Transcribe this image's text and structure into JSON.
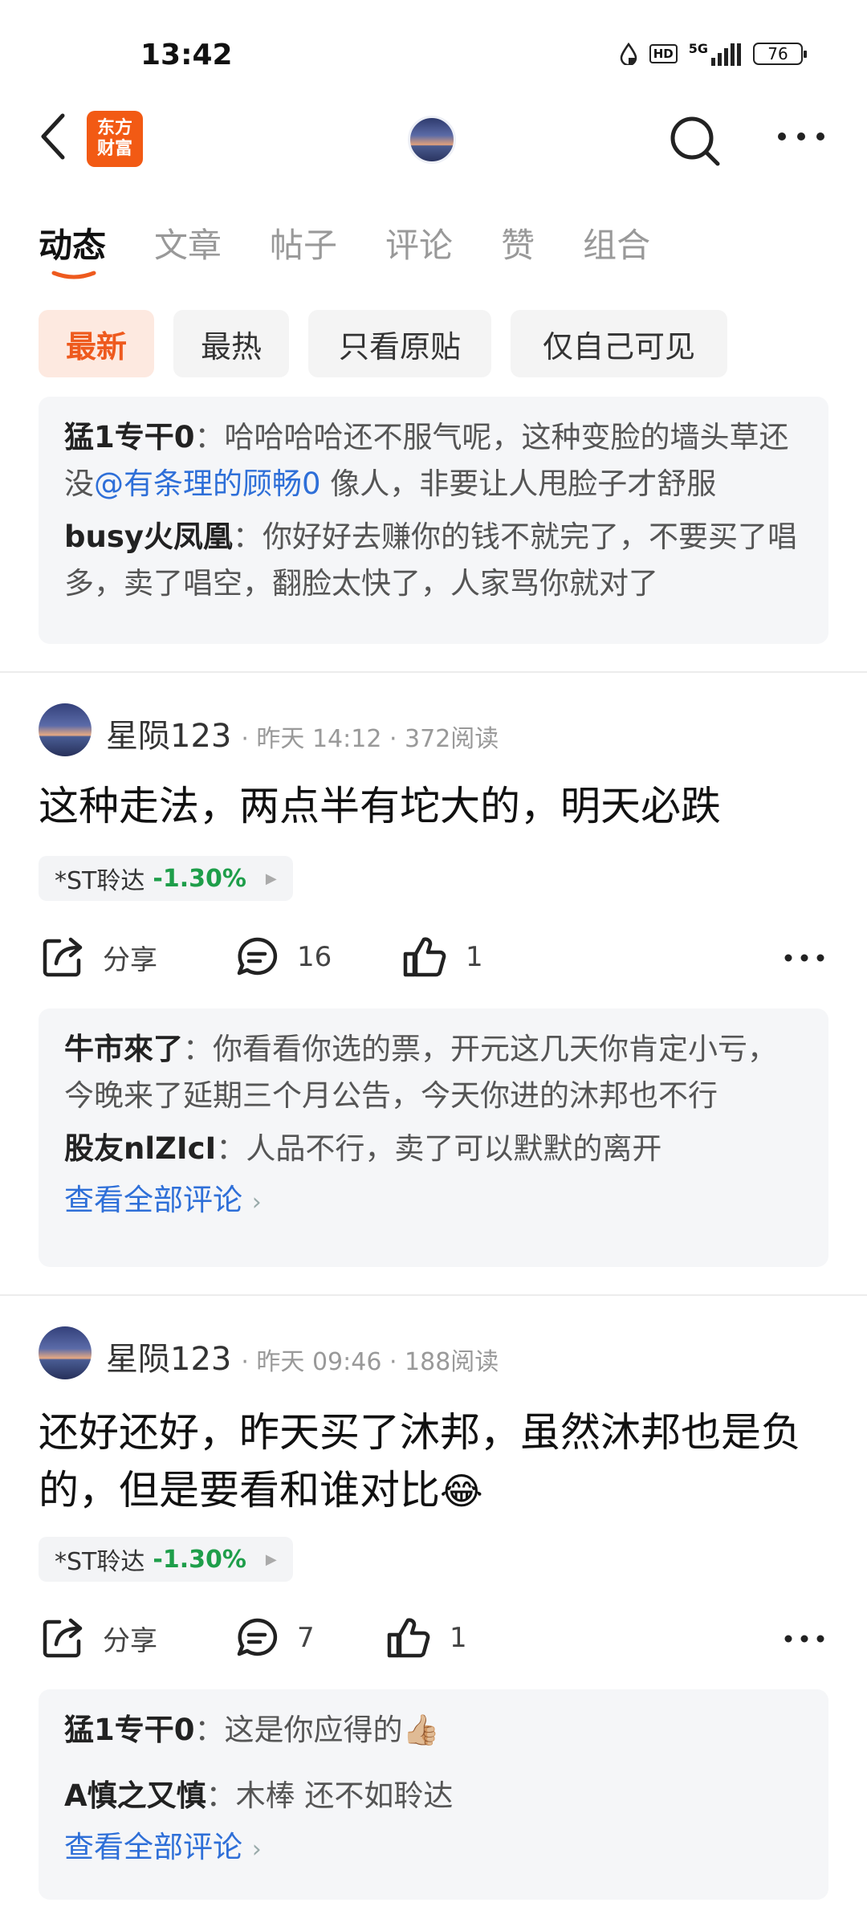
{
  "status": {
    "time": "13:42",
    "net": "5G",
    "hd": "HD",
    "battery": "76"
  },
  "header": {
    "logo_line1": "东方",
    "logo_line2": "财富"
  },
  "tabs": [
    {
      "label": "动态"
    },
    {
      "label": "文章"
    },
    {
      "label": "帖子"
    },
    {
      "label": "评论"
    },
    {
      "label": "赞"
    },
    {
      "label": "组合"
    }
  ],
  "filters": [
    {
      "label": "最新"
    },
    {
      "label": "最热"
    },
    {
      "label": "只看原贴"
    },
    {
      "label": "仅自己可见"
    }
  ],
  "top_comments": [
    {
      "user": "猛1专干0",
      "sep": "：",
      "text_a": "哈哈哈哈还不服气呢，这种变脸的墙头草还没",
      "mention": "@有条理的顾畅0",
      "text_b": " 像人，非要让人甩脸子才舒服"
    },
    {
      "user": "busy火凤凰",
      "sep": "：",
      "text_a": "你好好去赚你的钱不就完了，不要买了唱多，卖了唱空，翻脸太快了，人家骂你就对了"
    }
  ],
  "posts": [
    {
      "author": "星陨123",
      "meta": "· 昨天 14:12 · 372阅读",
      "body": "这种走法，两点半有坨大的，明天必跌",
      "stock_name": "*ST聆达",
      "stock_pct": "-1.30%",
      "share_label": "分享",
      "comments": "16",
      "likes": "1",
      "replies": [
        {
          "user": "牛市來了",
          "sep": "：",
          "text": "你看看你选的票，开元这几天你肯定小亏，今晚来了延期三个月公告，今天你进的沐邦也不行"
        },
        {
          "user": "股友nlZIcI",
          "sep": "：",
          "text": "人品不行，卖了可以默默的离开"
        }
      ],
      "see_all": "查看全部评论"
    },
    {
      "author": "星陨123",
      "meta": "· 昨天 09:46 · 188阅读",
      "body": "还好还好，昨天买了沐邦，虽然沐邦也是负的，但是要看和谁对比",
      "body_emoji": "😂",
      "stock_name": "*ST聆达",
      "stock_pct": "-1.30%",
      "share_label": "分享",
      "comments": "7",
      "likes": "1",
      "replies": [
        {
          "user": "猛1专干0",
          "sep": "：",
          "text": "这是你应得的",
          "emoji": "👍🏼"
        },
        {
          "user": "A慎之又慎",
          "sep": "：",
          "text": "木棒 还不如聆达"
        }
      ],
      "see_all": "查看全部评论"
    }
  ],
  "colors": {
    "accent": "#ee5a1e",
    "link": "#2e6fd8",
    "down": "#1e9e4a"
  },
  "icons": [
    "back-icon",
    "search-icon",
    "more-icon",
    "share-icon",
    "comment-icon",
    "like-icon",
    "chevron-right-icon"
  ]
}
